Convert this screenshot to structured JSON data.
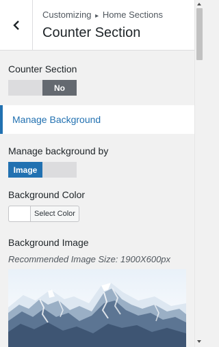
{
  "header": {
    "back_icon": "chevron-left-icon",
    "breadcrumb_prefix": "Customizing",
    "breadcrumb_separator": "▸",
    "breadcrumb_section": "Home Sections",
    "title": "Counter Section"
  },
  "counter_section": {
    "label": "Counter Section",
    "toggle_value": "No",
    "enabled": false
  },
  "manage_background_link": "Manage Background",
  "manage_by": {
    "label": "Manage background by",
    "selected": "Image"
  },
  "background_color": {
    "label": "Background Color",
    "button_label": "Select Color",
    "current_color": "#ffffff"
  },
  "background_image": {
    "label": "Background Image",
    "description": "Recommended Image Size: 1900X600px"
  },
  "colors": {
    "accent": "#2271b1",
    "toggle_off": "#646970"
  }
}
